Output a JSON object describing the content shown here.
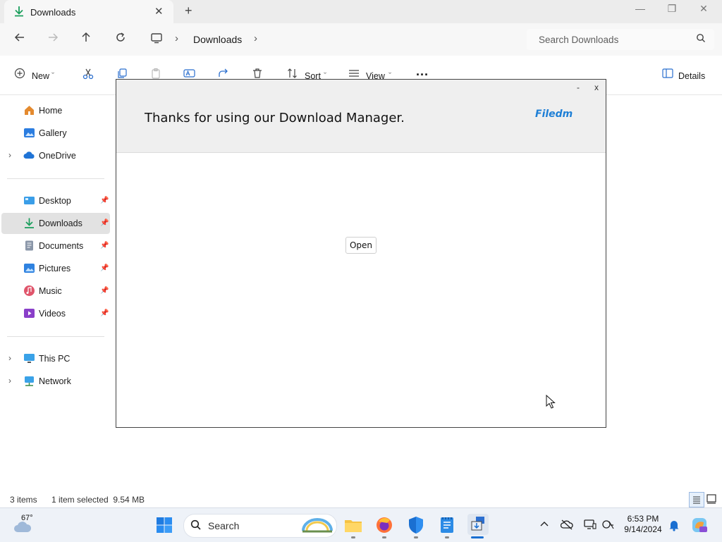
{
  "window": {
    "tab_label": "Downloads",
    "new_tab_glyph": "+",
    "tab_close_glyph": "✕",
    "minimize_glyph": "—",
    "maximize_glyph": "❐",
    "close_glyph": "✕"
  },
  "address": {
    "crumbs": [
      "Downloads"
    ],
    "search_placeholder": "Search Downloads"
  },
  "toolbar": {
    "new_label": "New",
    "sort_label": "Sort",
    "view_label": "View",
    "more_label": "···",
    "details_label": "Details"
  },
  "sidebar": {
    "items": [
      {
        "label": "Home",
        "icon": "home-icon"
      },
      {
        "label": "Gallery",
        "icon": "gallery-icon"
      },
      {
        "label": "OneDrive",
        "icon": "cloud-icon"
      },
      {
        "label": "Desktop",
        "icon": "desktop-icon"
      },
      {
        "label": "Downloads",
        "icon": "download-icon"
      },
      {
        "label": "Documents",
        "icon": "documents-icon"
      },
      {
        "label": "Pictures",
        "icon": "pictures-icon"
      },
      {
        "label": "Music",
        "icon": "music-icon"
      },
      {
        "label": "Videos",
        "icon": "videos-icon"
      },
      {
        "label": "This PC",
        "icon": "pc-icon"
      },
      {
        "label": "Network",
        "icon": "network-icon"
      }
    ],
    "selected": "Downloads"
  },
  "status": {
    "items_count": "3 items",
    "selection": "1 item selected  9.54 MB"
  },
  "dialog": {
    "message": "Thanks for using our Download Manager.",
    "brand": "Filedm",
    "minimize_label": "-",
    "close_label": "x",
    "open_button": "Open"
  },
  "taskbar": {
    "weather_temp": "67°",
    "search_placeholder": "Search",
    "time": "6:53 PM",
    "date": "9/14/2024"
  },
  "colors": {
    "accent": "#1e7fd6",
    "download_green": "#1a9e5c",
    "selected_bg": "#e2e2e2"
  }
}
